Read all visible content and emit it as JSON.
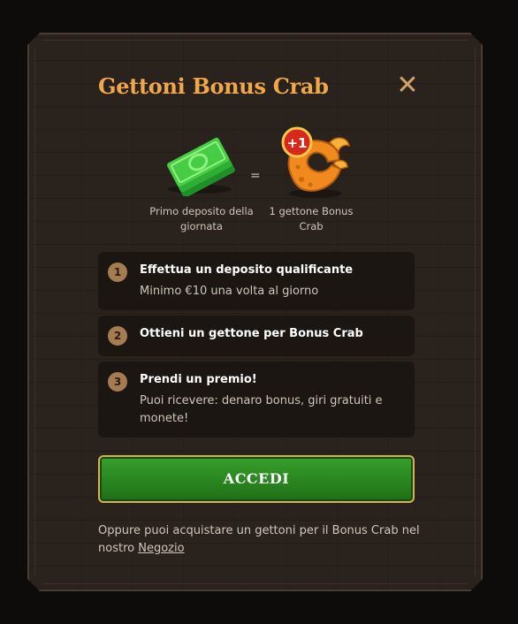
{
  "modal": {
    "title": "Gettoni Bonus Crab",
    "close_icon": "close-icon"
  },
  "exchange": {
    "left_icon": "money-stack-icon",
    "left_caption": "Primo deposito della giornata",
    "equals": "=",
    "right_icon": "crab-claw-token-icon",
    "right_badge": "+1",
    "right_caption": "1 gettone Bonus Crab"
  },
  "steps": [
    {
      "number": "1",
      "title": "Effettua un deposito qualificante",
      "description": "Minimo €10 una volta al giorno"
    },
    {
      "number": "2",
      "title": "Ottieni un gettone per Bonus Crab",
      "description": ""
    },
    {
      "number": "3",
      "title": "Prendi un premio!",
      "description": "Puoi ricevere: denaro bonus, giri gratuiti e monete!"
    }
  ],
  "login_button": "ACCEDI",
  "footer": {
    "text": "Oppure puoi acquistare un gettoni per il Bonus Crab nel nostro",
    "link": "Negozio"
  },
  "colors": {
    "title": "#f0a64a",
    "button_green": "#2e8f22",
    "button_border": "#d9b04e",
    "panel": "#2a231d",
    "step_bg": "#1b1612"
  }
}
